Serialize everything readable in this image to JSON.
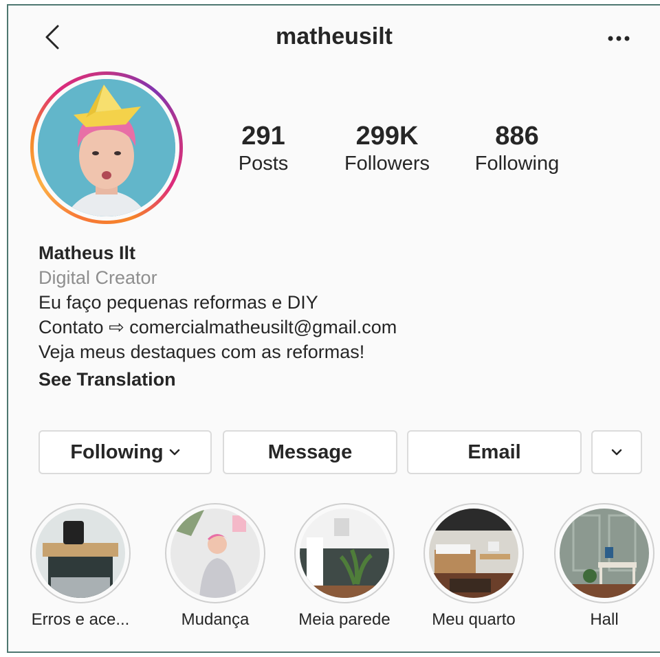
{
  "header": {
    "username": "matheusilt",
    "back_icon": "chevron-left-icon",
    "more_icon": "more-horizontal-icon"
  },
  "stats": [
    {
      "value": "291",
      "label": "Posts"
    },
    {
      "value": "299K",
      "label": "Followers"
    },
    {
      "value": "886",
      "label": "Following"
    }
  ],
  "bio": {
    "name": "Matheus Ilt",
    "category": "Digital Creator",
    "line1": "Eu faço pequenas reformas e DIY",
    "line2": "Contato ⇨ comercialmatheusilt@gmail.com",
    "line3": "Veja meus destaques com as reformas!",
    "translate": "See Translation"
  },
  "buttons": {
    "following": "Following",
    "message": "Message",
    "email": "Email",
    "chevron_icon": "chevron-down-icon"
  },
  "highlights": [
    {
      "label": "Erros e ace..."
    },
    {
      "label": "Mudança"
    },
    {
      "label": "Meia parede"
    },
    {
      "label": "Meu quarto"
    },
    {
      "label": "Hall"
    }
  ],
  "colors": {
    "background": "#fafafa",
    "text": "#262626",
    "secondary_text": "#8e8e8e",
    "border": "#dbdbdb",
    "frame": "#4d7770"
  }
}
